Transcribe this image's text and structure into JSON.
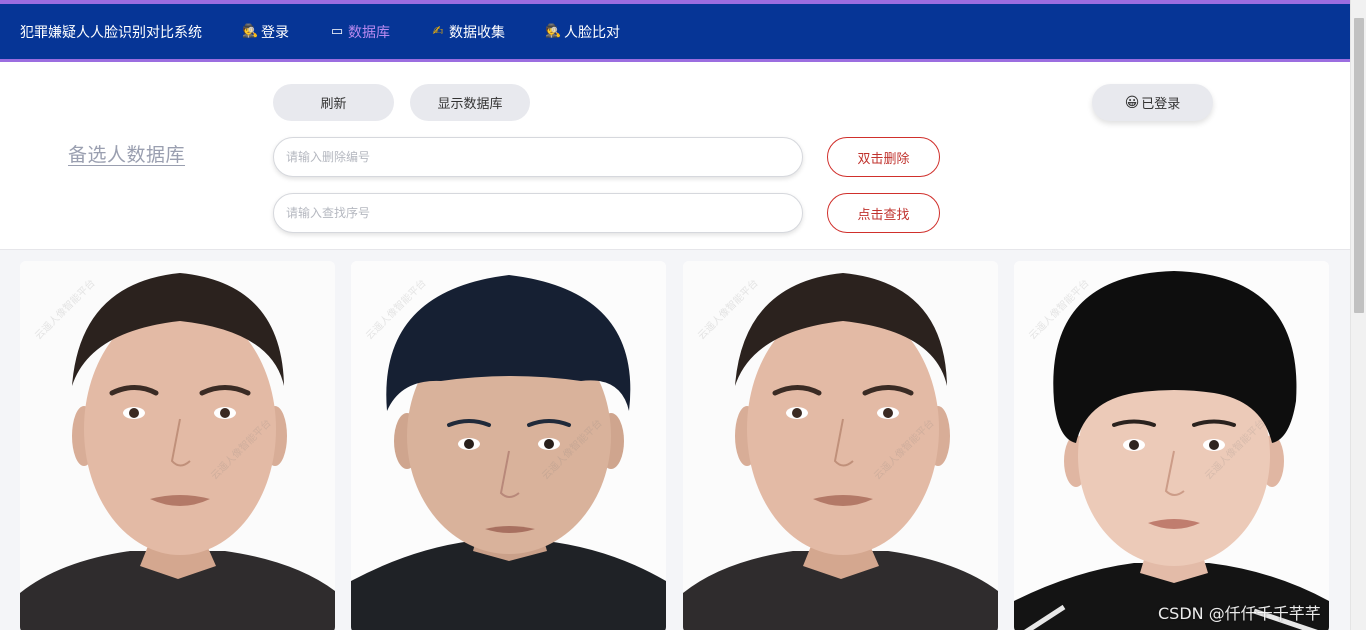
{
  "nav": {
    "brand": "犯罪嫌疑人人脸识别对比系统",
    "items": [
      {
        "icon": "detective-emoji-icon",
        "glyph": "🕵",
        "label": "登录"
      },
      {
        "icon": "database-card-icon",
        "glyph": "▭",
        "label": "数据库"
      },
      {
        "icon": "writing-hand-icon",
        "glyph": "✍",
        "label": "数据收集"
      },
      {
        "icon": "detective-emoji-icon",
        "glyph": "🕵",
        "label": "人脸比对"
      }
    ]
  },
  "panel": {
    "title": "备选人数据库",
    "refresh_label": "刷新",
    "show_db_label": "显示数据库",
    "login_status_glyph": "😀",
    "login_status_label": "已登录",
    "delete_placeholder": "请输入删除编号",
    "delete_button": "双击删除",
    "find_placeholder": "请输入查找序号",
    "find_button": "点击查找"
  },
  "cards": [
    {
      "name": "suspect-photo-1",
      "hair": "buzz",
      "shirt": "dark"
    },
    {
      "name": "suspect-photo-2",
      "hair": "bowl",
      "shirt": "black"
    },
    {
      "name": "suspect-photo-3",
      "hair": "buzz",
      "shirt": "dark"
    },
    {
      "name": "suspect-photo-4",
      "hair": "mushroom",
      "shirt": "black-white-stripe"
    }
  ],
  "watermark": {
    "line1": "林晨",
    "line2": "云遥人像智能平台"
  },
  "credit": "CSDN @仟仟千千芊芊",
  "colors": {
    "nav_bg": "#063596",
    "nav_border": "#9b6de0",
    "active": "#b98af0",
    "danger": "#d0302c"
  }
}
